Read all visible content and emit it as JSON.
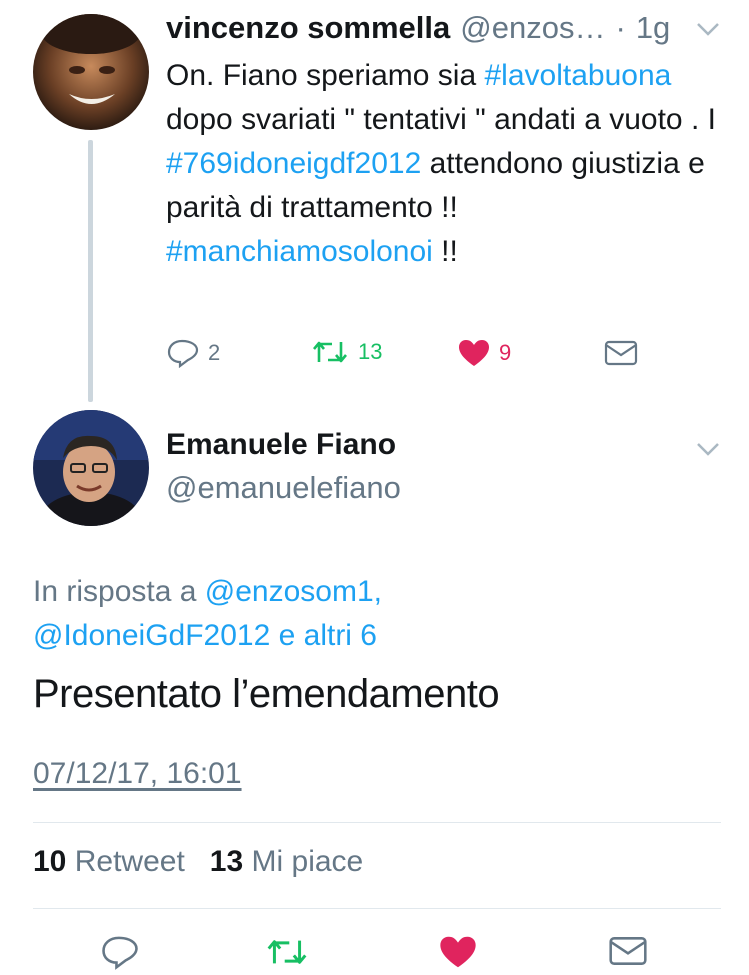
{
  "colors": {
    "link": "#1da1f2",
    "retweet": "#17bf63",
    "like": "#e0245e",
    "muted": "#657786",
    "text": "#14171a"
  },
  "reply_tweet": {
    "name": "vincenzo sommella",
    "handle": "@enzos…",
    "dot": "·",
    "time": "1g",
    "text_parts": [
      {
        "t": "On. Fiano speriamo sia ",
        "tag": false
      },
      {
        "t": "#lavoltabuona",
        "tag": true
      },
      {
        "t": " dopo svariati \" tentativi \" andati a vuoto . I ",
        "tag": false
      },
      {
        "t": "#769idoneigdf2012",
        "tag": true
      },
      {
        "t": " attendono giustizia e parità di trattamento !! ",
        "tag": false
      },
      {
        "t": "#manchiamosolonoi",
        "tag": true
      },
      {
        "t": " !!",
        "tag": false
      }
    ],
    "actions": {
      "replies": "2",
      "retweets": "13",
      "likes": "9"
    }
  },
  "main_tweet": {
    "name": "Emanuele Fiano",
    "handle": "@emanuelefiano",
    "reply_prefix": "In risposta a ",
    "reply_mention1": "@enzosom1,",
    "reply_mention2": "@IdoneiGdF2012 e altri 6",
    "text": "Presentato l’emendamento",
    "timestamp": "07/12/17, 16:01",
    "retweet_count": "10",
    "retweet_label": "Retweet",
    "like_count": "13",
    "like_label": "Mi piace"
  },
  "icons": [
    "reply-icon",
    "retweet-icon",
    "heart-icon",
    "dm-icon",
    "chevron-down-icon"
  ]
}
